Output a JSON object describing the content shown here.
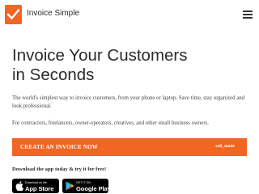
{
  "header": {
    "logo_text": "Invoice Simple",
    "brand_color": "#f26522",
    "logo_icon": "checkmark-icon",
    "menu_icon": "hamburger-menu-icon"
  },
  "hero": {
    "title_line1": "Invoice Your Customers",
    "title_line2": "in Seconds",
    "description": "The world's simplest way to invoice customers, from your phone or laptop. Save time, stay organized and look professional.",
    "audience": "For contractors, freelancers, owner-operators, creatives, and other small business owners."
  },
  "cta": {
    "label": "CREATE AN INVOICE NOW",
    "tag": "roll_mode",
    "color": "#f26522"
  },
  "download": {
    "text": "Download the app today & try it for free!",
    "app_store": {
      "small": "Download on the",
      "big": "App Store",
      "icon": "apple-icon"
    },
    "google_play": {
      "small": "GET IT ON",
      "big": "Google Play",
      "icon": "google-play-icon"
    }
  }
}
